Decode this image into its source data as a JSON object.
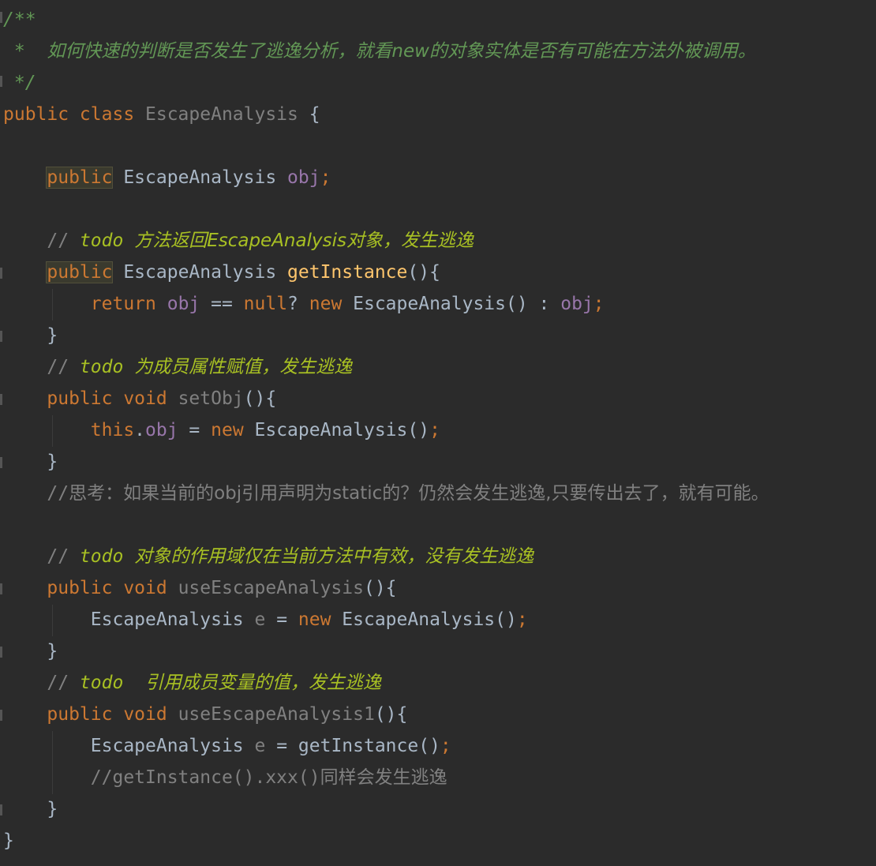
{
  "editor": {
    "lines": [
      {
        "tokens": [
          {
            "t": "/**",
            "c": "doc"
          }
        ]
      },
      {
        "tokens": [
          {
            "t": " *  ",
            "c": "doc"
          },
          {
            "t": "如何快速的判断是否发生了逃逸分析，就看new的对象实体是否有可能在方法外被调用。",
            "c": "doc cjk"
          }
        ]
      },
      {
        "tokens": [
          {
            "t": " */",
            "c": "doc"
          }
        ]
      },
      {
        "tokens": [
          {
            "t": "public class ",
            "c": "kw"
          },
          {
            "t": "EscapeAnalysis",
            "c": "unused"
          },
          {
            "t": " {",
            "c": "plain"
          }
        ]
      },
      {
        "tokens": []
      },
      {
        "tokens": [
          {
            "t": "    ",
            "c": "plain"
          },
          {
            "t": "public",
            "c": "kw hl"
          },
          {
            "t": " EscapeAnalysis ",
            "c": "plain"
          },
          {
            "t": "obj",
            "c": "field"
          },
          {
            "t": ";",
            "c": "kw"
          }
        ]
      },
      {
        "tokens": []
      },
      {
        "tokens": [
          {
            "t": "    // ",
            "c": "comment"
          },
          {
            "t": "todo ",
            "c": "todo"
          },
          {
            "t": "方法返回EscapeAnalysis对象，发生逃逸",
            "c": "todo cjk"
          }
        ]
      },
      {
        "tokens": [
          {
            "t": "    ",
            "c": "plain"
          },
          {
            "t": "public",
            "c": "kw hl"
          },
          {
            "t": " EscapeAnalysis ",
            "c": "plain"
          },
          {
            "t": "getInstance",
            "c": "method"
          },
          {
            "t": "(){",
            "c": "plain"
          }
        ]
      },
      {
        "tokens": [
          {
            "t": "        ",
            "c": "plain"
          },
          {
            "t": "return ",
            "c": "kw"
          },
          {
            "t": "obj",
            "c": "field"
          },
          {
            "t": " == ",
            "c": "plain"
          },
          {
            "t": "null",
            "c": "kw"
          },
          {
            "t": "? ",
            "c": "plain"
          },
          {
            "t": "new ",
            "c": "kw"
          },
          {
            "t": "EscapeAnalysis() : ",
            "c": "plain"
          },
          {
            "t": "obj",
            "c": "field"
          },
          {
            "t": ";",
            "c": "kw"
          }
        ]
      },
      {
        "tokens": [
          {
            "t": "    }",
            "c": "plain"
          }
        ]
      },
      {
        "tokens": [
          {
            "t": "    // ",
            "c": "comment"
          },
          {
            "t": "todo ",
            "c": "todo"
          },
          {
            "t": "为成员属性赋值，发生逃逸",
            "c": "todo cjk"
          }
        ]
      },
      {
        "tokens": [
          {
            "t": "    ",
            "c": "plain"
          },
          {
            "t": "public void ",
            "c": "kw"
          },
          {
            "t": "setObj",
            "c": "unused"
          },
          {
            "t": "(){",
            "c": "plain"
          }
        ]
      },
      {
        "tokens": [
          {
            "t": "        ",
            "c": "plain"
          },
          {
            "t": "this",
            "c": "kw"
          },
          {
            "t": ".",
            "c": "plain"
          },
          {
            "t": "obj",
            "c": "field"
          },
          {
            "t": " = ",
            "c": "plain"
          },
          {
            "t": "new ",
            "c": "kw"
          },
          {
            "t": "EscapeAnalysis()",
            "c": "plain"
          },
          {
            "t": ";",
            "c": "kw"
          }
        ]
      },
      {
        "tokens": [
          {
            "t": "    }",
            "c": "plain"
          }
        ]
      },
      {
        "tokens": [
          {
            "t": "    //",
            "c": "comment"
          },
          {
            "t": "思考：如果当前的obj引用声明为static的？仍然会发生逃逸,只要传出去了，就有可能。",
            "c": "comment cjk"
          }
        ]
      },
      {
        "tokens": []
      },
      {
        "tokens": [
          {
            "t": "    // ",
            "c": "comment"
          },
          {
            "t": "todo ",
            "c": "todo"
          },
          {
            "t": "对象的作用域仅在当前方法中有效，没有发生逃逸",
            "c": "todo cjk"
          }
        ]
      },
      {
        "tokens": [
          {
            "t": "    ",
            "c": "plain"
          },
          {
            "t": "public void ",
            "c": "kw"
          },
          {
            "t": "useEscapeAnalysis",
            "c": "unused"
          },
          {
            "t": "(){",
            "c": "plain"
          }
        ]
      },
      {
        "tokens": [
          {
            "t": "        EscapeAnalysis ",
            "c": "plain"
          },
          {
            "t": "e",
            "c": "unused"
          },
          {
            "t": " = ",
            "c": "plain"
          },
          {
            "t": "new ",
            "c": "kw"
          },
          {
            "t": "EscapeAnalysis()",
            "c": "plain"
          },
          {
            "t": ";",
            "c": "kw"
          }
        ]
      },
      {
        "tokens": [
          {
            "t": "    }",
            "c": "plain"
          }
        ]
      },
      {
        "tokens": [
          {
            "t": "    // ",
            "c": "comment"
          },
          {
            "t": "todo  ",
            "c": "todo"
          },
          {
            "t": "引用成员变量的值，发生逃逸",
            "c": "todo cjk"
          }
        ]
      },
      {
        "tokens": [
          {
            "t": "    ",
            "c": "plain"
          },
          {
            "t": "public void ",
            "c": "kw"
          },
          {
            "t": "useEscapeAnalysis1",
            "c": "unused"
          },
          {
            "t": "(){",
            "c": "plain"
          }
        ]
      },
      {
        "tokens": [
          {
            "t": "        EscapeAnalysis ",
            "c": "plain"
          },
          {
            "t": "e",
            "c": "unused"
          },
          {
            "t": " = getInstance()",
            "c": "plain"
          },
          {
            "t": ";",
            "c": "kw"
          }
        ]
      },
      {
        "tokens": [
          {
            "t": "        //getInstance().xxx()",
            "c": "comment"
          },
          {
            "t": "同样会发生逃逸",
            "c": "comment cjk"
          }
        ]
      },
      {
        "tokens": [
          {
            "t": "    }",
            "c": "plain"
          }
        ]
      },
      {
        "tokens": [
          {
            "t": "}",
            "c": "plain"
          }
        ]
      }
    ],
    "theme": {
      "background": "#2b2b2b",
      "keyword": "#cc7832",
      "field": "#9876aa",
      "method": "#ffc66d",
      "doc_comment": "#629755",
      "todo": "#a8c023",
      "comment": "#808080"
    }
  }
}
